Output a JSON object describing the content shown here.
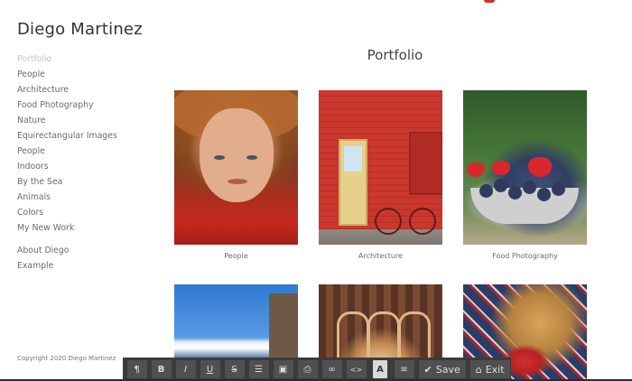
{
  "site": {
    "title": "Diego Martinez",
    "copyright": "Copyright 2020 Diego Martinez"
  },
  "nav": {
    "items": [
      {
        "label": "Portfolio",
        "active": true
      },
      {
        "label": "People"
      },
      {
        "label": "Architecture"
      },
      {
        "label": "Food Photography"
      },
      {
        "label": "Nature"
      },
      {
        "label": "Equirectangular Images"
      },
      {
        "label": "People"
      },
      {
        "label": "Indoors"
      },
      {
        "label": "By the Sea"
      },
      {
        "label": "Animals"
      },
      {
        "label": "Colors"
      },
      {
        "label": "My New Work"
      }
    ],
    "secondary": [
      {
        "label": "About Diego"
      },
      {
        "label": "Example"
      }
    ]
  },
  "main": {
    "title": "Portfolio",
    "gallery": [
      {
        "caption": "People",
        "image": "portrait-woman-hat"
      },
      {
        "caption": "Architecture",
        "image": "red-brick-door-bicycle"
      },
      {
        "caption": "Food Photography",
        "image": "berries-bowl"
      },
      {
        "caption": "",
        "image": "mountain-sky-building"
      },
      {
        "caption": "",
        "image": "interior-arches"
      },
      {
        "caption": "",
        "image": "red-cup-plaid"
      }
    ]
  },
  "toolbar": {
    "buttons": [
      {
        "name": "paragraph-icon",
        "glyph": "¶"
      },
      {
        "name": "bold-icon",
        "glyph": "B"
      },
      {
        "name": "italic-icon",
        "glyph": "I"
      },
      {
        "name": "underline-icon",
        "glyph": "U"
      },
      {
        "name": "strikethrough-icon",
        "glyph": "S"
      },
      {
        "name": "list-icon",
        "glyph": "☰"
      },
      {
        "name": "image-icon",
        "glyph": "▣"
      },
      {
        "name": "embed-icon",
        "glyph": "⎙"
      },
      {
        "name": "link-icon",
        "glyph": "∞"
      },
      {
        "name": "code-icon",
        "glyph": "<>"
      },
      {
        "name": "font-icon",
        "glyph": "A"
      },
      {
        "name": "align-icon",
        "glyph": "≡"
      }
    ],
    "save_label": "Save",
    "exit_label": "Exit",
    "save_icon": "check-icon",
    "exit_icon": "home-icon"
  },
  "colors": {
    "accent": "#d32a2a",
    "toolbar_bg": "#3b3b3b"
  }
}
